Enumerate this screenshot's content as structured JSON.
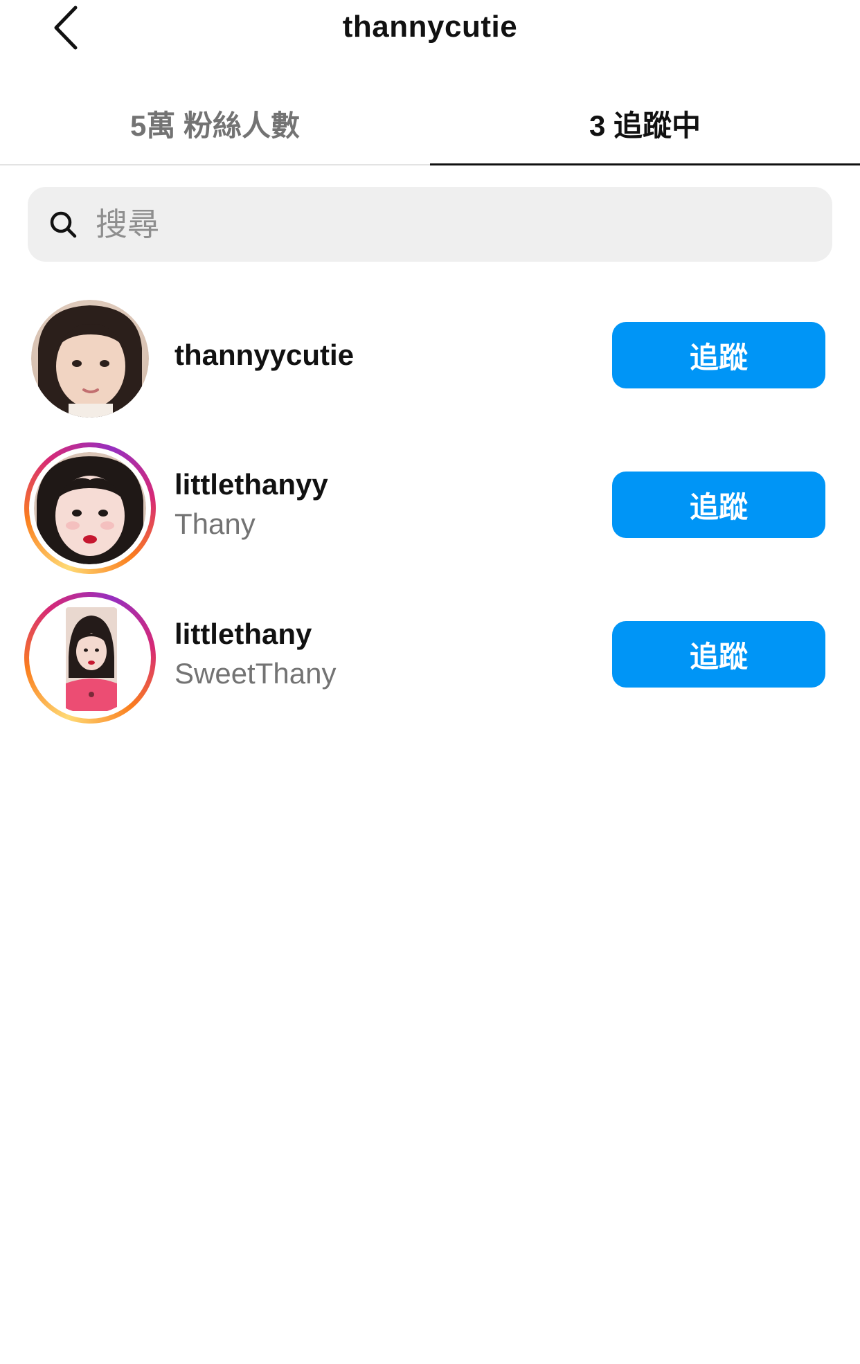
{
  "header": {
    "title": "thannycutie",
    "back_icon": "chevron-left-icon"
  },
  "tabs": [
    {
      "label": "5萬 粉絲人數",
      "active": false
    },
    {
      "label": "3 追蹤中",
      "active": true
    }
  ],
  "search": {
    "placeholder": "搜尋",
    "value": "",
    "icon": "search-icon"
  },
  "colors": {
    "accent": "#0095f6",
    "secondary_text": "#737373",
    "search_bg": "#efefef"
  },
  "following": [
    {
      "username": "thannyycutie",
      "full_name": "",
      "has_story_ring": false,
      "button_label": "追蹤"
    },
    {
      "username": "littlethanyy",
      "full_name": "Thany",
      "has_story_ring": true,
      "button_label": "追蹤"
    },
    {
      "username": "littlethany",
      "full_name": "SweetThany",
      "has_story_ring": true,
      "button_label": "追蹤"
    }
  ]
}
